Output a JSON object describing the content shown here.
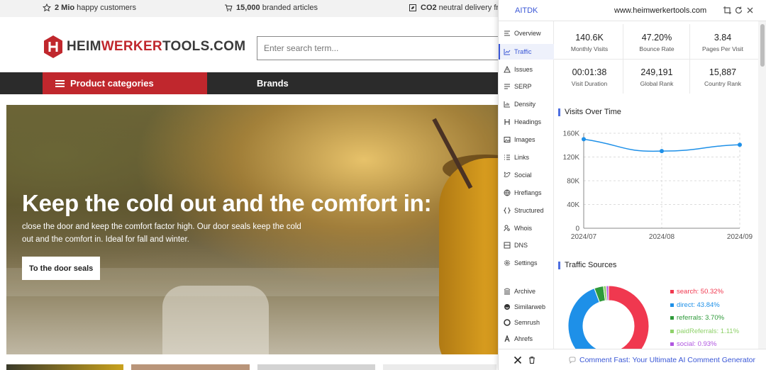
{
  "topbar": {
    "items": [
      {
        "strong": "2 Mio",
        "rest": " happy customers",
        "icon": "star-icon"
      },
      {
        "strong": "15,000",
        "rest": " branded articles",
        "icon": "cart-icon"
      },
      {
        "strong": "CO2",
        "rest": " neutral delivery from",
        "icon": "leaf-box-icon"
      }
    ]
  },
  "header": {
    "logo_part1": "HEIM",
    "logo_part2": "WERKER",
    "logo_part3": "TOOLS.COM",
    "search_placeholder": "Enter search term..."
  },
  "nav": {
    "categories_label": "Product categories",
    "brands_label": "Brands"
  },
  "hero": {
    "title": "Keep the cold out and the comfort in:",
    "text": "close the door and keep the comfort factor high. Our door seals keep the cold out and the comfort in. Ideal for fall and winter.",
    "button_label": "To the door seals"
  },
  "extension": {
    "brand": "AITDK",
    "url": "www.heimwerkertools.com",
    "sidebar": [
      {
        "label": "Overview",
        "icon": "list-icon"
      },
      {
        "label": "Traffic",
        "icon": "chart-icon",
        "active": true
      },
      {
        "label": "Issues",
        "icon": "warning-icon"
      },
      {
        "label": "SERP",
        "icon": "serp-icon"
      },
      {
        "label": "Density",
        "icon": "density-icon"
      },
      {
        "label": "Headings",
        "icon": "heading-icon"
      },
      {
        "label": "Images",
        "icon": "image-icon"
      },
      {
        "label": "Links",
        "icon": "links-icon"
      },
      {
        "label": "Social",
        "icon": "bird-icon"
      },
      {
        "label": "Hreflangs",
        "icon": "globe-icon"
      },
      {
        "label": "Structured",
        "icon": "braces-icon"
      },
      {
        "label": "Whois",
        "icon": "user-search-icon"
      },
      {
        "label": "DNS",
        "icon": "dns-icon"
      },
      {
        "label": "Settings",
        "icon": "gear-icon"
      },
      {
        "label": "Archive",
        "icon": "archive-icon"
      },
      {
        "label": "Similarweb",
        "icon": "similarweb-icon"
      },
      {
        "label": "Semrush",
        "icon": "semrush-icon"
      },
      {
        "label": "Ahrefs",
        "icon": "ahrefs-icon"
      }
    ],
    "metrics": [
      {
        "value": "140.6K",
        "label": "Monthly Visits"
      },
      {
        "value": "47.20%",
        "label": "Bounce Rate"
      },
      {
        "value": "3.84",
        "label": "Pages Per Visit"
      },
      {
        "value": "00:01:38",
        "label": "Visit Duration"
      },
      {
        "value": "249,191",
        "label": "Global Rank"
      },
      {
        "value": "15,887",
        "label": "Country Rank"
      }
    ],
    "visits_title": "Visits Over Time",
    "sources_title": "Traffic Sources",
    "bottom_link": "Comment Fast: Your Ultimate AI Comment Generator",
    "colors": {
      "accent": "#3a57d6",
      "line": "#1e90e8"
    }
  },
  "chart_data": [
    {
      "type": "line",
      "title": "Visits Over Time",
      "x": [
        "2024/07",
        "2024/08",
        "2024/09"
      ],
      "series": [
        {
          "values": [
            150000,
            130000,
            140600
          ]
        }
      ],
      "yticks": [
        "0",
        "40K",
        "80K",
        "120K",
        "160K"
      ],
      "ylim": [
        0,
        160000
      ],
      "grid": true
    },
    {
      "type": "pie",
      "title": "Traffic Sources",
      "donut": true,
      "categories": [
        "search: 50.32%",
        "direct: 43.84%",
        "referrals: 3.70%",
        "paidReferrals: 1.11%",
        "social: 0.93%"
      ],
      "values": [
        50.32,
        43.84,
        3.7,
        1.11,
        0.93
      ],
      "colors": [
        "#f0384f",
        "#1e90e8",
        "#2e9a3a",
        "#8fd16a",
        "#b057e0"
      ],
      "legend": "right"
    }
  ]
}
